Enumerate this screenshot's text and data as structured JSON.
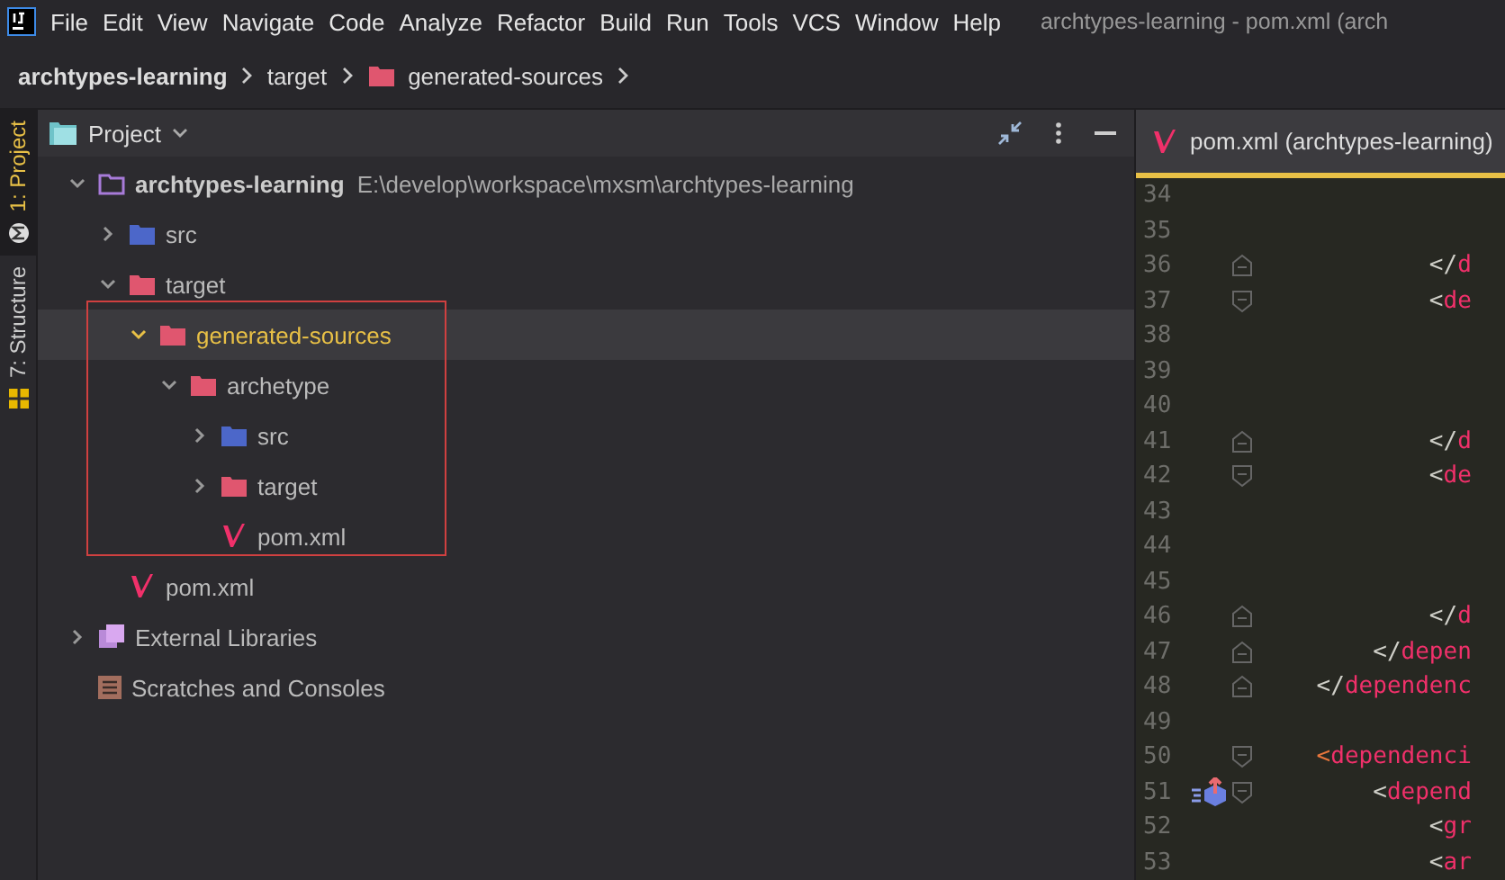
{
  "menu_bar": {
    "items": [
      "File",
      "Edit",
      "View",
      "Navigate",
      "Code",
      "Analyze",
      "Refactor",
      "Build",
      "Run",
      "Tools",
      "VCS",
      "Window",
      "Help"
    ],
    "window_title": "archtypes-learning - pom.xml (arch"
  },
  "breadcrumbs": [
    {
      "label": "archtypes-learning",
      "kind": "project"
    },
    {
      "label": "target",
      "kind": "plain"
    },
    {
      "label": "generated-sources",
      "kind": "folder"
    }
  ],
  "tool_strip": [
    {
      "label": "1: Project",
      "selected": true,
      "kind": "maven"
    },
    {
      "label": "7: Structure",
      "selected": false,
      "kind": "structure"
    }
  ],
  "project_panel": {
    "title": "Project",
    "tree": [
      {
        "label": "archtypes-learning",
        "path": "E:\\develop\\workspace\\mxsm\\archtypes-learning",
        "kind": "module",
        "expanded": true,
        "selected": false,
        "highlighted": false,
        "children": [
          {
            "label": "src",
            "kind": "source",
            "expanded": false,
            "selected": false,
            "highlighted": false
          },
          {
            "label": "target",
            "kind": "folder",
            "expanded": true,
            "selected": false,
            "highlighted": false,
            "children": [
              {
                "label": "generated-sources",
                "kind": "folder",
                "expanded": true,
                "selected": true,
                "highlighted": true,
                "children": [
                  {
                    "label": "archetype",
                    "kind": "folder",
                    "expanded": true,
                    "selected": false,
                    "highlighted": false,
                    "children": [
                      {
                        "label": "src",
                        "kind": "source",
                        "expanded": false,
                        "selected": false,
                        "highlighted": false
                      },
                      {
                        "label": "target",
                        "kind": "folder",
                        "expanded": false,
                        "selected": false,
                        "highlighted": false
                      },
                      {
                        "label": "pom.xml",
                        "kind": "maven",
                        "selected": false,
                        "highlighted": false
                      }
                    ]
                  }
                ]
              }
            ]
          },
          {
            "label": "pom.xml",
            "kind": "maven",
            "selected": false,
            "highlighted": false
          }
        ]
      },
      {
        "label": "External Libraries",
        "kind": "library",
        "expanded": false,
        "selected": false,
        "highlighted": false
      },
      {
        "label": "Scratches and Consoles",
        "kind": "scratches",
        "selected": false,
        "highlighted": false
      }
    ]
  },
  "editor": {
    "tab": {
      "label": "pom.xml (archtypes-learning)",
      "selected": true
    },
    "lines": [
      {
        "number": "34",
        "kind": "plain",
        "marker": false
      },
      {
        "number": "35",
        "kind": "plain",
        "marker": false
      },
      {
        "number": "36",
        "kind": "fold_end",
        "marker": false,
        "code": [
          {
            "text": "            </",
            "kind": "punct"
          },
          {
            "text": "d",
            "kind": "tag"
          }
        ]
      },
      {
        "number": "37",
        "kind": "fold_start",
        "marker": false,
        "code": [
          {
            "text": "            <",
            "kind": "punct"
          },
          {
            "text": "de",
            "kind": "tag"
          }
        ]
      },
      {
        "number": "38",
        "kind": "plain",
        "marker": false
      },
      {
        "number": "39",
        "kind": "plain",
        "marker": false
      },
      {
        "number": "40",
        "kind": "plain",
        "marker": false
      },
      {
        "number": "41",
        "kind": "fold_end",
        "marker": false,
        "code": [
          {
            "text": "            </",
            "kind": "punct"
          },
          {
            "text": "d",
            "kind": "tag"
          }
        ]
      },
      {
        "number": "42",
        "kind": "fold_start",
        "marker": false,
        "code": [
          {
            "text": "            <",
            "kind": "punct"
          },
          {
            "text": "de",
            "kind": "tag"
          }
        ]
      },
      {
        "number": "43",
        "kind": "plain",
        "marker": false
      },
      {
        "number": "44",
        "kind": "plain",
        "marker": false
      },
      {
        "number": "45",
        "kind": "plain",
        "marker": false
      },
      {
        "number": "46",
        "kind": "fold_end",
        "marker": false,
        "code": [
          {
            "text": "            </",
            "kind": "punct"
          },
          {
            "text": "d",
            "kind": "tag"
          }
        ]
      },
      {
        "number": "47",
        "kind": "fold_end",
        "marker": false,
        "code": [
          {
            "text": "        </",
            "kind": "punct"
          },
          {
            "text": "depen",
            "kind": "tag"
          }
        ]
      },
      {
        "number": "48",
        "kind": "fold_end",
        "marker": false,
        "code": [
          {
            "text": "    </",
            "kind": "punct"
          },
          {
            "text": "dependenc",
            "kind": "tag"
          }
        ]
      },
      {
        "number": "49",
        "kind": "plain",
        "marker": false
      },
      {
        "number": "50",
        "kind": "fold_start",
        "marker": false,
        "code": [
          {
            "text": "    <",
            "kind": "accent"
          },
          {
            "text": "dependenci",
            "kind": "tag"
          }
        ]
      },
      {
        "number": "51",
        "kind": "fold_start",
        "marker": true,
        "code": [
          {
            "text": "        <",
            "kind": "punct"
          },
          {
            "text": "depend",
            "kind": "tag"
          }
        ]
      },
      {
        "number": "52",
        "kind": "plain",
        "marker": false,
        "code": [
          {
            "text": "            <",
            "kind": "punct"
          },
          {
            "text": "gr",
            "kind": "tag"
          }
        ]
      },
      {
        "number": "53",
        "kind": "plain",
        "marker": false,
        "code": [
          {
            "text": "            <",
            "kind": "punct"
          },
          {
            "text": "ar",
            "kind": "tag"
          }
        ]
      }
    ]
  }
}
